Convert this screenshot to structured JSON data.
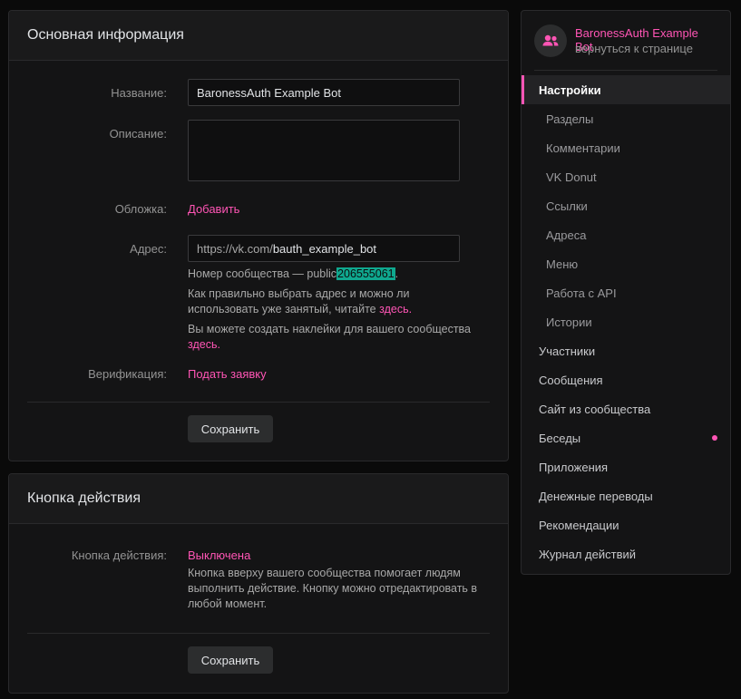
{
  "basic_info": {
    "title": "Основная информация",
    "name_label": "Название:",
    "name_value": "BaronessAuth Example Bot",
    "description_label": "Описание:",
    "cover_label": "Обложка:",
    "cover_action": "Добавить",
    "address_label": "Адрес:",
    "address_prefix": "https://vk.com/",
    "address_value": "bauth_example_bot",
    "community_number_prefix": "Номер сообщества — public",
    "community_number": "206555061",
    "community_number_suffix": ".",
    "address_hint_text": "Как правильно выбрать адрес и можно ли использовать уже занятый, читайте",
    "address_hint_link": "здесь.",
    "stickers_hint_text": "Вы можете создать наклейки для вашего сообщества",
    "stickers_hint_link": "здесь.",
    "verification_label": "Верификация:",
    "verification_action": "Подать заявку",
    "save_label": "Сохранить"
  },
  "action_button": {
    "title": "Кнопка действия",
    "label": "Кнопка действия:",
    "status": "Выключена",
    "description": "Кнопка вверху вашего сообщества помогает людям выполнить действие. Кнопку можно отредактировать в любой момент.",
    "save_label": "Сохранить"
  },
  "sidebar": {
    "community_name": "BaronessAuth Example Bot",
    "back_link": "вернуться к странице",
    "avatar_icon": "users-icon",
    "items": [
      {
        "label": "Настройки",
        "type": "top",
        "active": true
      },
      {
        "label": "Разделы",
        "type": "sub"
      },
      {
        "label": "Комментарии",
        "type": "sub"
      },
      {
        "label": "VK Donut",
        "type": "sub"
      },
      {
        "label": "Ссылки",
        "type": "sub"
      },
      {
        "label": "Адреса",
        "type": "sub"
      },
      {
        "label": "Меню",
        "type": "sub"
      },
      {
        "label": "Работа с API",
        "type": "sub"
      },
      {
        "label": "Истории",
        "type": "sub"
      },
      {
        "label": "Участники",
        "type": "top"
      },
      {
        "label": "Сообщения",
        "type": "top"
      },
      {
        "label": "Сайт из сообщества",
        "type": "top"
      },
      {
        "label": "Беседы",
        "type": "top",
        "badge_dot": true
      },
      {
        "label": "Приложения",
        "type": "top"
      },
      {
        "label": "Денежные переводы",
        "type": "top"
      },
      {
        "label": "Рекомендации",
        "type": "top"
      },
      {
        "label": "Журнал действий",
        "type": "top"
      }
    ]
  },
  "colors": {
    "accent": "#ff55b5",
    "highlight": "#0fa88f",
    "background": "#0a0a0a",
    "panel": "#141415"
  }
}
